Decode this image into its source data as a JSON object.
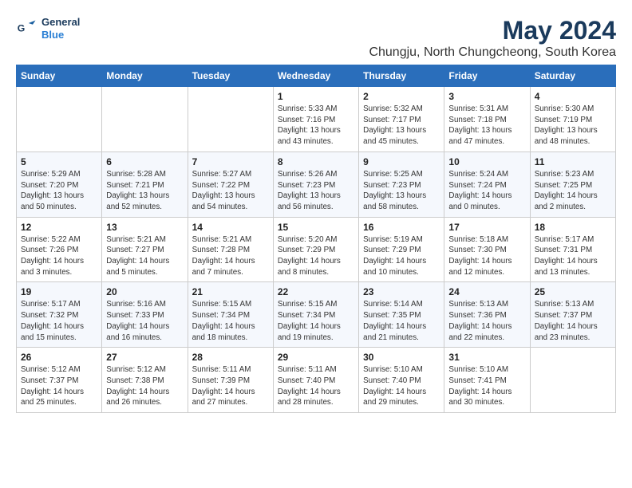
{
  "logo": {
    "line1": "General",
    "line2": "Blue"
  },
  "title": "May 2024",
  "subtitle": "Chungju, North Chungcheong, South Korea",
  "days_of_week": [
    "Sunday",
    "Monday",
    "Tuesday",
    "Wednesday",
    "Thursday",
    "Friday",
    "Saturday"
  ],
  "weeks": [
    [
      {
        "day": "",
        "info": ""
      },
      {
        "day": "",
        "info": ""
      },
      {
        "day": "",
        "info": ""
      },
      {
        "day": "1",
        "info": "Sunrise: 5:33 AM\nSunset: 7:16 PM\nDaylight: 13 hours\nand 43 minutes."
      },
      {
        "day": "2",
        "info": "Sunrise: 5:32 AM\nSunset: 7:17 PM\nDaylight: 13 hours\nand 45 minutes."
      },
      {
        "day": "3",
        "info": "Sunrise: 5:31 AM\nSunset: 7:18 PM\nDaylight: 13 hours\nand 47 minutes."
      },
      {
        "day": "4",
        "info": "Sunrise: 5:30 AM\nSunset: 7:19 PM\nDaylight: 13 hours\nand 48 minutes."
      }
    ],
    [
      {
        "day": "5",
        "info": "Sunrise: 5:29 AM\nSunset: 7:20 PM\nDaylight: 13 hours\nand 50 minutes."
      },
      {
        "day": "6",
        "info": "Sunrise: 5:28 AM\nSunset: 7:21 PM\nDaylight: 13 hours\nand 52 minutes."
      },
      {
        "day": "7",
        "info": "Sunrise: 5:27 AM\nSunset: 7:22 PM\nDaylight: 13 hours\nand 54 minutes."
      },
      {
        "day": "8",
        "info": "Sunrise: 5:26 AM\nSunset: 7:23 PM\nDaylight: 13 hours\nand 56 minutes."
      },
      {
        "day": "9",
        "info": "Sunrise: 5:25 AM\nSunset: 7:23 PM\nDaylight: 13 hours\nand 58 minutes."
      },
      {
        "day": "10",
        "info": "Sunrise: 5:24 AM\nSunset: 7:24 PM\nDaylight: 14 hours\nand 0 minutes."
      },
      {
        "day": "11",
        "info": "Sunrise: 5:23 AM\nSunset: 7:25 PM\nDaylight: 14 hours\nand 2 minutes."
      }
    ],
    [
      {
        "day": "12",
        "info": "Sunrise: 5:22 AM\nSunset: 7:26 PM\nDaylight: 14 hours\nand 3 minutes."
      },
      {
        "day": "13",
        "info": "Sunrise: 5:21 AM\nSunset: 7:27 PM\nDaylight: 14 hours\nand 5 minutes."
      },
      {
        "day": "14",
        "info": "Sunrise: 5:21 AM\nSunset: 7:28 PM\nDaylight: 14 hours\nand 7 minutes."
      },
      {
        "day": "15",
        "info": "Sunrise: 5:20 AM\nSunset: 7:29 PM\nDaylight: 14 hours\nand 8 minutes."
      },
      {
        "day": "16",
        "info": "Sunrise: 5:19 AM\nSunset: 7:29 PM\nDaylight: 14 hours\nand 10 minutes."
      },
      {
        "day": "17",
        "info": "Sunrise: 5:18 AM\nSunset: 7:30 PM\nDaylight: 14 hours\nand 12 minutes."
      },
      {
        "day": "18",
        "info": "Sunrise: 5:17 AM\nSunset: 7:31 PM\nDaylight: 14 hours\nand 13 minutes."
      }
    ],
    [
      {
        "day": "19",
        "info": "Sunrise: 5:17 AM\nSunset: 7:32 PM\nDaylight: 14 hours\nand 15 minutes."
      },
      {
        "day": "20",
        "info": "Sunrise: 5:16 AM\nSunset: 7:33 PM\nDaylight: 14 hours\nand 16 minutes."
      },
      {
        "day": "21",
        "info": "Sunrise: 5:15 AM\nSunset: 7:34 PM\nDaylight: 14 hours\nand 18 minutes."
      },
      {
        "day": "22",
        "info": "Sunrise: 5:15 AM\nSunset: 7:34 PM\nDaylight: 14 hours\nand 19 minutes."
      },
      {
        "day": "23",
        "info": "Sunrise: 5:14 AM\nSunset: 7:35 PM\nDaylight: 14 hours\nand 21 minutes."
      },
      {
        "day": "24",
        "info": "Sunrise: 5:13 AM\nSunset: 7:36 PM\nDaylight: 14 hours\nand 22 minutes."
      },
      {
        "day": "25",
        "info": "Sunrise: 5:13 AM\nSunset: 7:37 PM\nDaylight: 14 hours\nand 23 minutes."
      }
    ],
    [
      {
        "day": "26",
        "info": "Sunrise: 5:12 AM\nSunset: 7:37 PM\nDaylight: 14 hours\nand 25 minutes."
      },
      {
        "day": "27",
        "info": "Sunrise: 5:12 AM\nSunset: 7:38 PM\nDaylight: 14 hours\nand 26 minutes."
      },
      {
        "day": "28",
        "info": "Sunrise: 5:11 AM\nSunset: 7:39 PM\nDaylight: 14 hours\nand 27 minutes."
      },
      {
        "day": "29",
        "info": "Sunrise: 5:11 AM\nSunset: 7:40 PM\nDaylight: 14 hours\nand 28 minutes."
      },
      {
        "day": "30",
        "info": "Sunrise: 5:10 AM\nSunset: 7:40 PM\nDaylight: 14 hours\nand 29 minutes."
      },
      {
        "day": "31",
        "info": "Sunrise: 5:10 AM\nSunset: 7:41 PM\nDaylight: 14 hours\nand 30 minutes."
      },
      {
        "day": "",
        "info": ""
      }
    ]
  ]
}
